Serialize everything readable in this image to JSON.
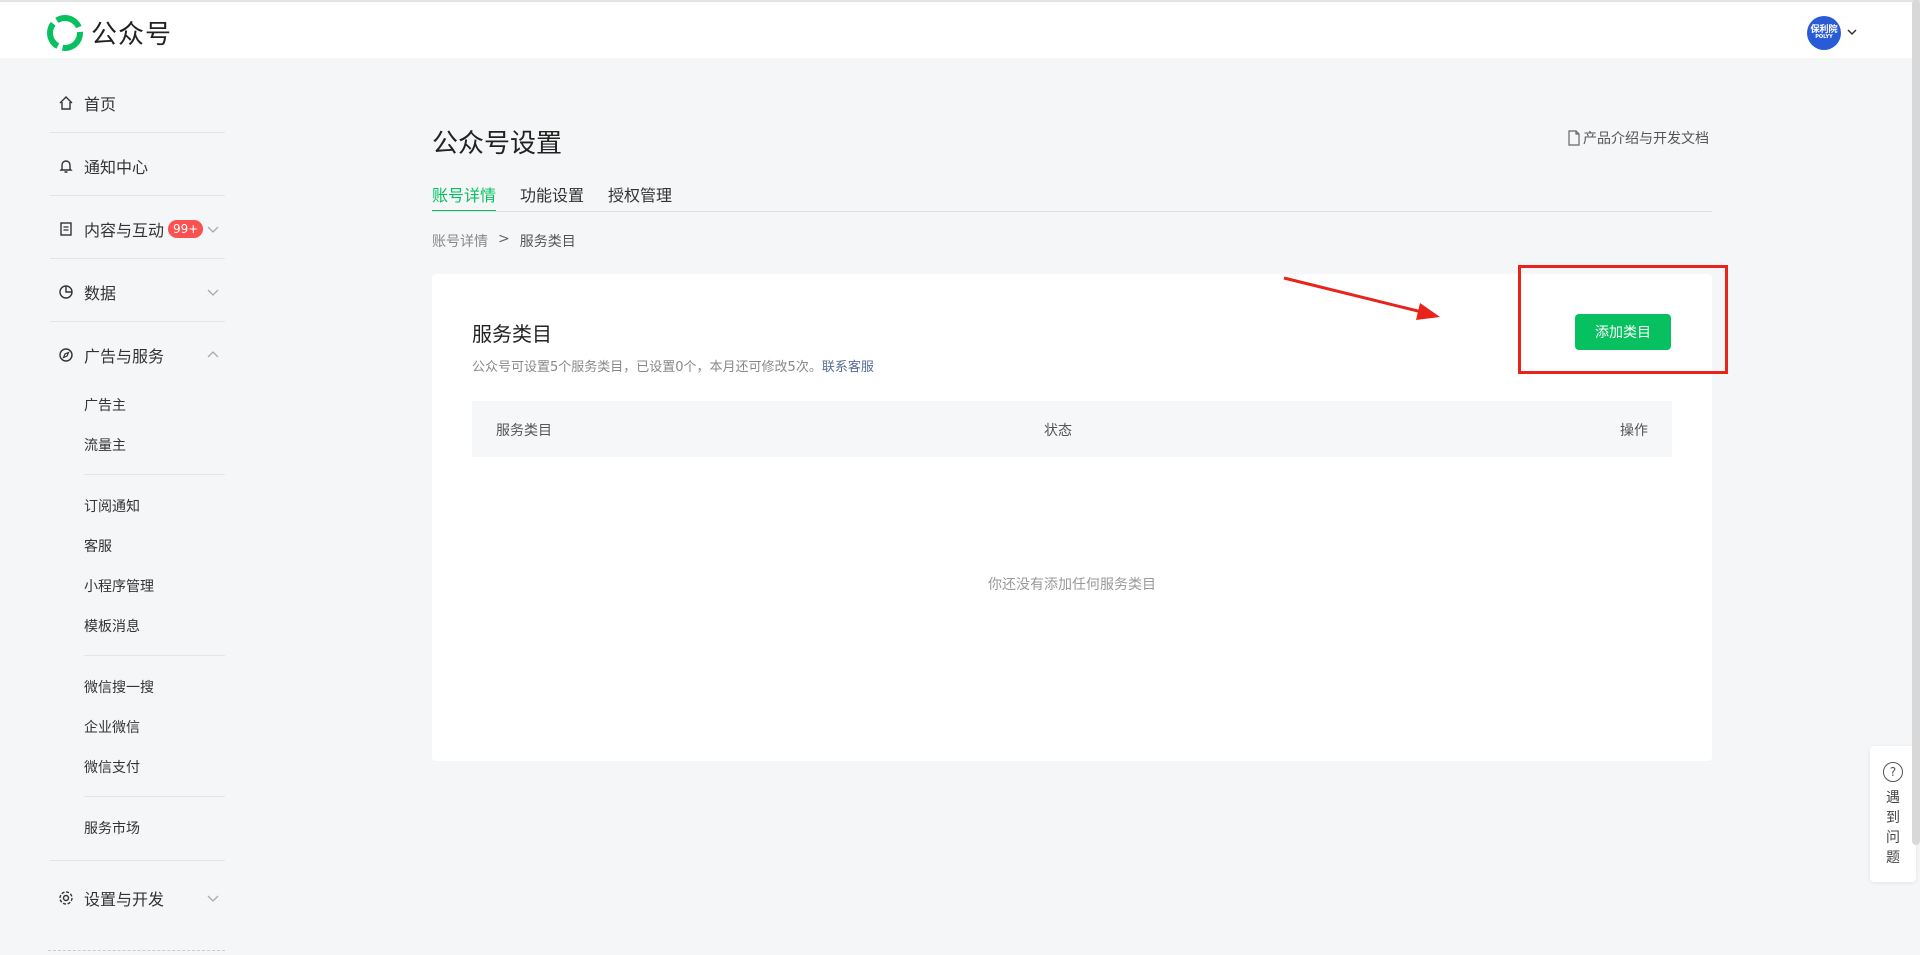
{
  "header": {
    "logo_text": "公众号",
    "avatar_text": "保利院",
    "avatar_sub": "POLYY"
  },
  "sidebar": {
    "main_items": [
      {
        "label": "首页",
        "icon": "home-icon"
      },
      {
        "label": "通知中心",
        "icon": "bell-icon"
      },
      {
        "label": "内容与互动",
        "icon": "document-icon",
        "badge": "99+"
      },
      {
        "label": "数据",
        "icon": "pie-chart-icon"
      },
      {
        "label": "广告与服务",
        "icon": "compass-icon"
      },
      {
        "label": "设置与开发",
        "icon": "gear-icon"
      }
    ],
    "sub_items": [
      "广告主",
      "流量主",
      "订阅通知",
      "客服",
      "小程序管理",
      "模板消息",
      "微信搜一搜",
      "企业微信",
      "微信支付",
      "服务市场"
    ]
  },
  "page": {
    "title": "公众号设置",
    "doc_link": "产品介绍与开发文档",
    "tabs": [
      "账号详情",
      "功能设置",
      "授权管理"
    ],
    "breadcrumb": {
      "parent": "账号详情",
      "sep": ">",
      "current": "服务类目"
    }
  },
  "card": {
    "title": "服务类目",
    "desc": "公众号可设置5个服务类目，已设置0个，本月还可修改5次。",
    "desc_link": "联系客服",
    "add_button": "添加类目",
    "columns": [
      "服务类目",
      "状态",
      "操作"
    ],
    "empty_text": "你还没有添加任何服务类目"
  },
  "help": {
    "text": "遇到问题",
    "icon": "question-icon"
  },
  "colors": {
    "accent": "#07c160",
    "badge": "#fa5151",
    "annotation": "#e8231a",
    "link": "#576b95"
  }
}
